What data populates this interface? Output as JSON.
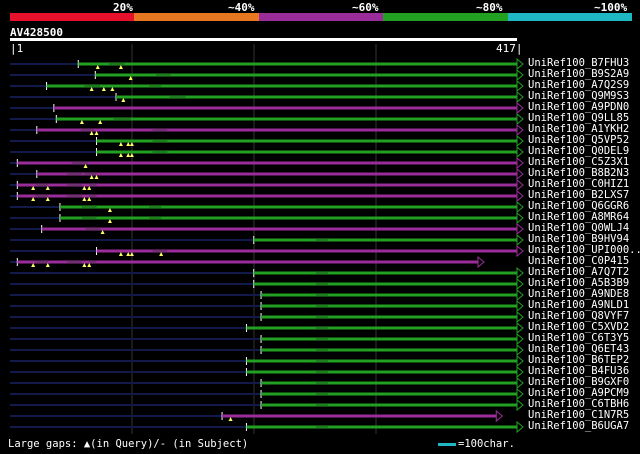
{
  "scale": {
    "labels": [
      "20%",
      "~40%",
      "~60%",
      "~80%",
      "~100%"
    ],
    "colors": [
      "#e8112d",
      "#e87722",
      "#9b2d9b",
      "#22a022",
      "#1fb7c4"
    ]
  },
  "query": {
    "id": "AV428500",
    "start": "1",
    "end": "417",
    "length": 417
  },
  "hits": [
    {
      "label": "UniRef100_B7FHU3",
      "color": "green",
      "start": 57,
      "gaps": [
        [
          82,
          95
        ]
      ],
      "marks": [
        73,
        92
      ],
      "flat": true
    },
    {
      "label": "UniRef100_B9S2A9",
      "color": "green",
      "start": 71,
      "gaps": [
        [
          121,
          133
        ]
      ],
      "marks": [
        100
      ],
      "flat": true
    },
    {
      "label": "UniRef100_A7Q2S9",
      "color": "green",
      "start": 31,
      "gaps": [
        [
          62,
          75
        ],
        [
          115,
          125
        ]
      ],
      "marks": [
        68,
        78,
        85
      ],
      "flat": true
    },
    {
      "label": "UniRef100_Q9M9S3",
      "color": "green",
      "start": 88,
      "gaps": [
        [
          132,
          145
        ]
      ],
      "marks": [
        94
      ],
      "flat": true
    },
    {
      "label": "UniRef100_A9PDN0",
      "color": "purple",
      "start": 37,
      "gaps": [],
      "marks": [],
      "flat": true
    },
    {
      "label": "UniRef100_Q9LL85",
      "color": "green",
      "start": 39,
      "gaps": [
        [
          86,
          100
        ]
      ],
      "marks": [
        60,
        75
      ],
      "flat": true
    },
    {
      "label": "UniRef100_A1YKH2",
      "color": "purple",
      "start": 23,
      "gaps": [
        [
          59,
          70
        ],
        [
          118,
          130
        ]
      ],
      "marks": [
        68,
        72
      ],
      "flat": true
    },
    {
      "label": "UniRef100_Q5VP52",
      "color": "green",
      "start": 72,
      "gaps": [
        [
          118,
          130
        ]
      ],
      "marks": [
        92,
        98,
        101
      ],
      "flat": false
    },
    {
      "label": "UniRef100_Q0DEL9",
      "color": "green",
      "start": 72,
      "gaps": [
        [
          118,
          130
        ]
      ],
      "marks": [
        92,
        98,
        101
      ],
      "flat": false
    },
    {
      "label": "UniRef100_C5Z3X1",
      "color": "purple",
      "start": 7,
      "gaps": [
        [
          52,
          65
        ]
      ],
      "marks": [
        63
      ],
      "flat": true
    },
    {
      "label": "UniRef100_B8B2N3",
      "color": "purple",
      "start": 23,
      "gaps": [
        [
          48,
          60
        ],
        [
          62,
          72
        ]
      ],
      "marks": [
        68,
        72
      ],
      "flat": false
    },
    {
      "label": "UniRef100_C0HIZ1",
      "color": "purple",
      "start": 7,
      "gaps": [
        [
          22,
          32
        ],
        [
          48,
          60
        ],
        [
          66,
          72
        ]
      ],
      "marks": [
        20,
        32,
        62,
        66
      ],
      "flat": false
    },
    {
      "label": "UniRef100_B2LXS7",
      "color": "purple",
      "start": 7,
      "gaps": [
        [
          22,
          32
        ],
        [
          48,
          60
        ],
        [
          66,
          72
        ]
      ],
      "marks": [
        20,
        32,
        62,
        66
      ],
      "flat": false
    },
    {
      "label": "UniRef100_Q6GGR6",
      "color": "green",
      "start": 42,
      "gaps": [
        [
          60,
          72
        ],
        [
          115,
          125
        ]
      ],
      "marks": [
        83
      ],
      "flat": true
    },
    {
      "label": "UniRef100_A8MR64",
      "color": "green",
      "start": 42,
      "gaps": [
        [
          60,
          72
        ],
        [
          115,
          125
        ]
      ],
      "marks": [
        83
      ],
      "flat": true
    },
    {
      "label": "UniRef100_Q0WLJ4",
      "color": "purple",
      "start": 27,
      "gaps": [
        [
          63,
          75
        ]
      ],
      "marks": [
        77
      ],
      "flat": true
    },
    {
      "label": "UniRef100_B9HV94",
      "color": "green",
      "start": 201,
      "gaps": [
        [
          252,
          262
        ]
      ],
      "marks": [],
      "flat": true
    },
    {
      "label": "UniRef100_UPI000...",
      "color": "purple",
      "start": 72,
      "gaps": [
        [
          118,
          130
        ]
      ],
      "marks": [
        92,
        98,
        101,
        125
      ],
      "flat": false
    },
    {
      "label": "UniRef100_C0P415",
      "color": "purple",
      "start": 7,
      "end": 385,
      "gaps": [
        [
          22,
          32
        ],
        [
          48,
          60
        ],
        [
          66,
          72
        ]
      ],
      "marks": [
        20,
        32,
        62,
        66
      ],
      "flat": false
    },
    {
      "label": "UniRef100_A7Q7T2",
      "color": "green",
      "start": 201,
      "gaps": [
        [
          252,
          262
        ]
      ],
      "marks": [],
      "flat": true
    },
    {
      "label": "UniRef100_A5B3B9",
      "color": "green",
      "start": 201,
      "gaps": [
        [
          252,
          262
        ]
      ],
      "marks": [],
      "flat": true
    },
    {
      "label": "UniRef100_A9NDE8",
      "color": "green",
      "start": 207,
      "gaps": [
        [
          252,
          262
        ]
      ],
      "marks": [],
      "flat": true
    },
    {
      "label": "UniRef100_A9NLD1",
      "color": "green",
      "start": 207,
      "gaps": [
        [
          252,
          262
        ]
      ],
      "marks": [],
      "flat": true
    },
    {
      "label": "UniRef100_Q8VYF7",
      "color": "green",
      "start": 207,
      "gaps": [
        [
          252,
          262
        ]
      ],
      "marks": [],
      "flat": true
    },
    {
      "label": "UniRef100_C5XVD2",
      "color": "green",
      "start": 195,
      "gaps": [
        [
          252,
          262
        ]
      ],
      "marks": [],
      "flat": true
    },
    {
      "label": "UniRef100_C6T3Y5",
      "color": "green",
      "start": 207,
      "gaps": [
        [
          252,
          262
        ]
      ],
      "marks": [],
      "flat": true
    },
    {
      "label": "UniRef100_Q6ET43",
      "color": "green",
      "start": 207,
      "gaps": [
        [
          252,
          262
        ]
      ],
      "marks": [],
      "flat": true
    },
    {
      "label": "UniRef100_B6TEP2",
      "color": "green",
      "start": 195,
      "gaps": [
        [
          252,
          262
        ]
      ],
      "marks": [],
      "flat": true
    },
    {
      "label": "UniRef100_B4FU36",
      "color": "green",
      "start": 195,
      "gaps": [
        [
          252,
          262
        ]
      ],
      "marks": [],
      "flat": true
    },
    {
      "label": "UniRef100_B9GXF0",
      "color": "green",
      "start": 207,
      "gaps": [
        [
          252,
          262
        ]
      ],
      "marks": [],
      "flat": true
    },
    {
      "label": "UniRef100_A9PCM9",
      "color": "green",
      "start": 207,
      "gaps": [
        [
          252,
          262
        ]
      ],
      "marks": [],
      "flat": true
    },
    {
      "label": "UniRef100_C6TBH6",
      "color": "green",
      "start": 207,
      "gaps": [
        [
          252,
          262
        ]
      ],
      "marks": [],
      "flat": true
    },
    {
      "label": "UniRef100_C1N7R5",
      "color": "purple",
      "start": 175,
      "end": 400,
      "gaps": [],
      "marks": [
        182
      ],
      "flat": true
    },
    {
      "label": "UniRef100_B6UGA7",
      "color": "green",
      "start": 195,
      "gaps": [
        [
          252,
          262
        ]
      ],
      "marks": [],
      "flat": true
    }
  ],
  "legend": {
    "gaps_text": "Large gaps: ▲(in Query)/- (in Subject)",
    "scale_text": "=100char."
  }
}
